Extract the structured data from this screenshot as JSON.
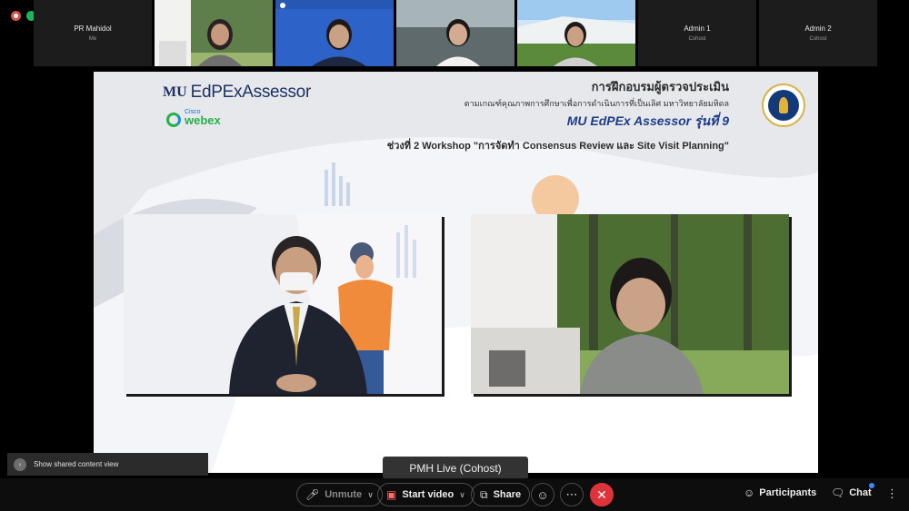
{
  "participants": [
    {
      "name": "PR Mahidol",
      "role": "Me",
      "video": false
    },
    {
      "name": "",
      "role": "",
      "video": true
    },
    {
      "name": "",
      "role": "",
      "video": true
    },
    {
      "name": "",
      "role": "",
      "video": true
    },
    {
      "name": "",
      "role": "",
      "video": true
    },
    {
      "name": "Admin 1",
      "role": "Cohost",
      "video": false
    },
    {
      "name": "Admin 2",
      "role": "Cohost",
      "video": false
    }
  ],
  "slide": {
    "logo_mark": "MU",
    "brand": "EdPExAssessor",
    "webex_cisco": "Cisco",
    "webex_name": "webex",
    "title_line1": "การฝึกอบรมผู้ตรวจประเมิน",
    "title_line2": "ตามเกณฑ์คุณภาพการศึกษาเพื่อการดำเนินการที่เป็นเลิศ มหาวิทยาลัยมหิดล",
    "title_line3": "MU EdPEx Assessor รุ่นที่ 9",
    "title_line4": "ช่วงที่ 2 Workshop \"การจัดทำ Consensus Review และ Site Visit Planning\""
  },
  "overlays": {
    "shared_view_label": "Show shared content view",
    "presenter_label": "PMH Live (Cohost)"
  },
  "controls": {
    "unmute_label": "Unmute",
    "start_video_label": "Start video",
    "share_label": "Share",
    "participants_label": "Participants",
    "chat_label": "Chat"
  },
  "colors": {
    "end_call": "#e0323a",
    "slide_bg": "#e7e8ec",
    "brand_navy": "#1d3366",
    "webex_green": "#25b04a"
  },
  "icons": [
    "recording-icon",
    "network-icon",
    "mic-off-icon",
    "video-off-icon",
    "share-icon",
    "reactions-icon",
    "more-icon",
    "end-call-icon",
    "participants-icon",
    "chat-icon",
    "shared-view-icon"
  ]
}
